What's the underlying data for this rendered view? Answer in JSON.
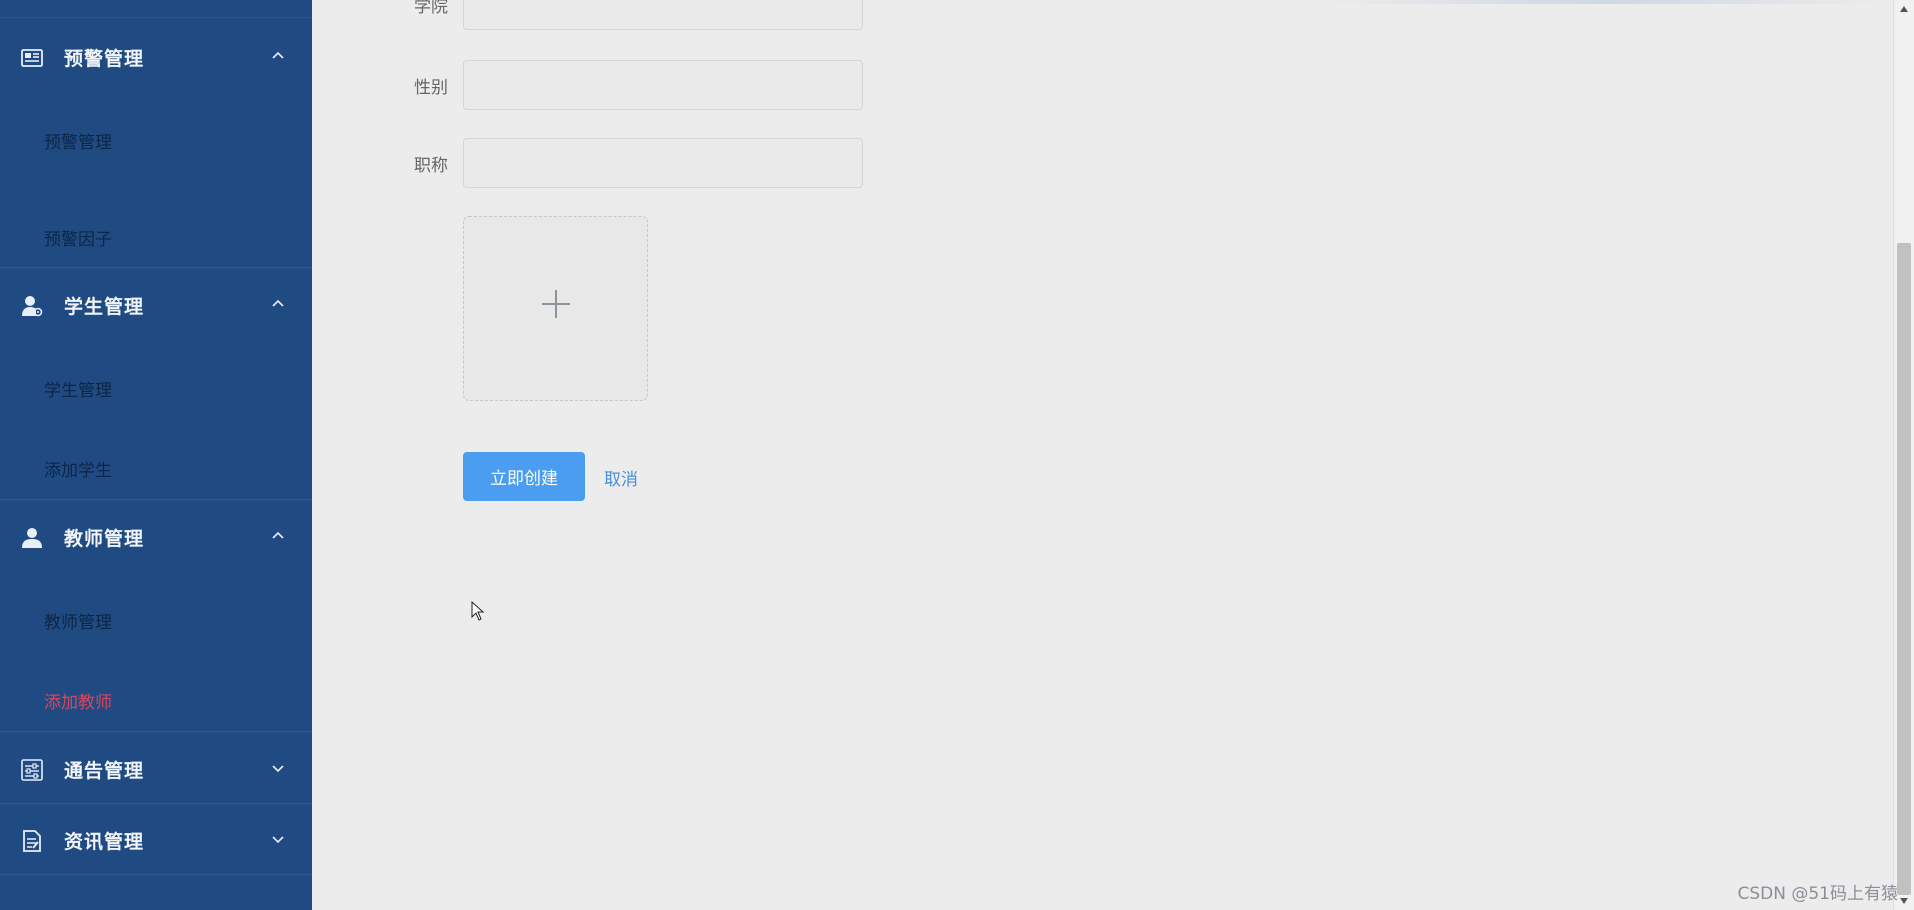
{
  "sidebar": {
    "groups": [
      {
        "label": "预警管理",
        "icon": "warning-card-icon",
        "expanded": true,
        "items": [
          {
            "label": "预警管理"
          },
          {
            "label": "预警因子"
          }
        ]
      },
      {
        "label": "学生管理",
        "icon": "student-user-icon",
        "expanded": true,
        "items": [
          {
            "label": "学生管理"
          },
          {
            "label": "添加学生"
          }
        ]
      },
      {
        "label": "教师管理",
        "icon": "teacher-user-icon",
        "expanded": true,
        "items": [
          {
            "label": "教师管理"
          },
          {
            "label": "添加教师",
            "active": true
          }
        ]
      },
      {
        "label": "通告管理",
        "icon": "notice-sliders-icon",
        "expanded": false,
        "items": []
      },
      {
        "label": "资讯管理",
        "icon": "news-document-icon",
        "expanded": false,
        "items": []
      }
    ]
  },
  "form": {
    "fields": [
      {
        "label": "学院",
        "value": ""
      },
      {
        "label": "性别",
        "value": ""
      },
      {
        "label": "职称",
        "value": ""
      }
    ],
    "upload_icon": "plus-icon",
    "submit_label": "立即创建",
    "cancel_label": "取消"
  },
  "watermark": "CSDN @51码上有猿",
  "colors": {
    "sidebar_bg": "#1f4b82",
    "active_item": "#d9455f",
    "primary_button": "#4a9df0",
    "link": "#4a8fd6",
    "page_bg": "#ececec"
  }
}
